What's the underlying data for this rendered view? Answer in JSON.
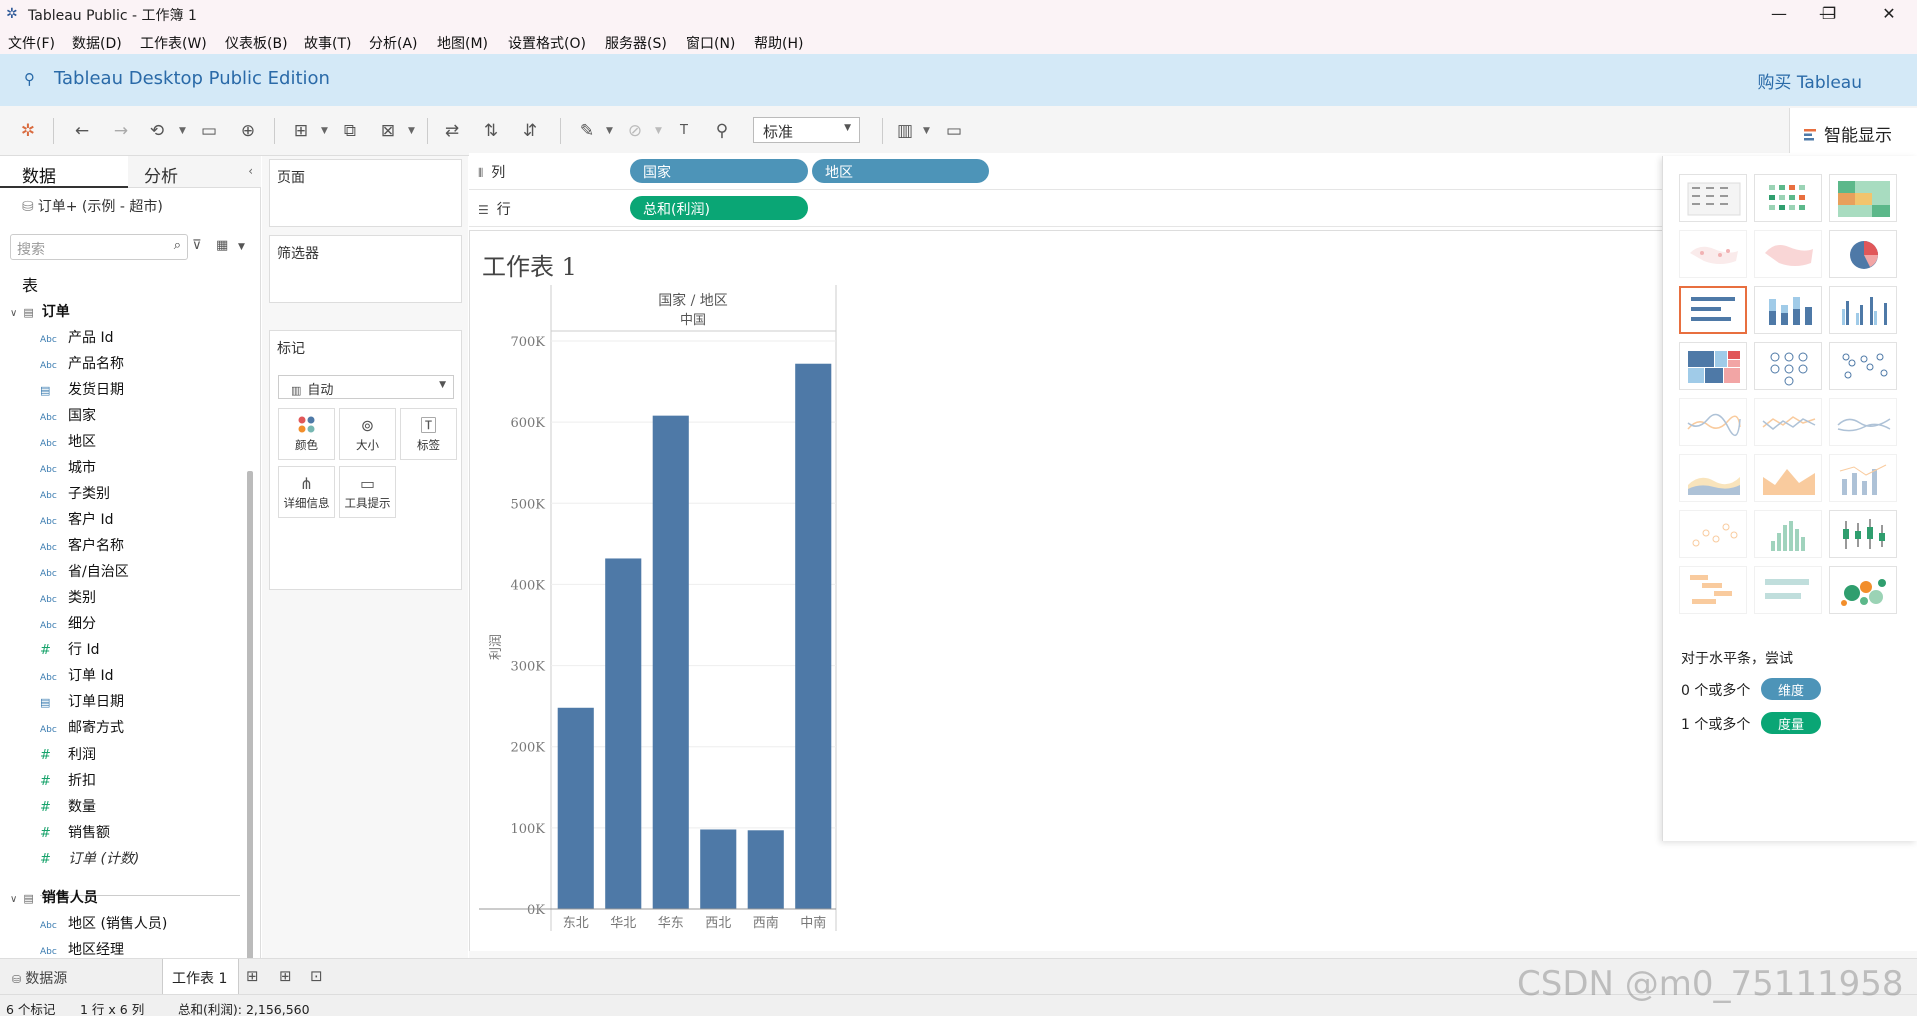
{
  "window": {
    "title": "Tableau Public - 工作簿 1",
    "minimize": "—",
    "restore": "❐",
    "close": "✕"
  },
  "menu": [
    "文件(F)",
    "数据(D)",
    "工作表(W)",
    "仪表板(B)",
    "故事(T)",
    "分析(A)",
    "地图(M)",
    "设置格式(O)",
    "服务器(S)",
    "窗口(N)",
    "帮助(H)"
  ],
  "banner": {
    "edition": "Tableau Desktop Public Edition",
    "buy": "购买 Tableau"
  },
  "toolbar": {
    "fit_value": "标准",
    "smart_show": "智能显示"
  },
  "data_pane": {
    "tab_data": "数据",
    "tab_analysis": "分析",
    "datasource": "订单+ (示例 - 超市)",
    "search_placeholder": "搜索",
    "tables_header": "表",
    "groups": [
      {
        "name": "订单",
        "fields": [
          {
            "type": "Abc",
            "name": "产品 Id"
          },
          {
            "type": "Abc",
            "name": "产品名称"
          },
          {
            "type": "date",
            "name": "发货日期"
          },
          {
            "type": "Abc",
            "name": "国家"
          },
          {
            "type": "Abc",
            "name": "地区"
          },
          {
            "type": "Abc",
            "name": "城市"
          },
          {
            "type": "Abc",
            "name": "子类别"
          },
          {
            "type": "Abc",
            "name": "客户 Id"
          },
          {
            "type": "Abc",
            "name": "客户名称"
          },
          {
            "type": "Abc",
            "name": "省/自治区"
          },
          {
            "type": "Abc",
            "name": "类别"
          },
          {
            "type": "Abc",
            "name": "细分"
          },
          {
            "type": "#",
            "name": "行 Id"
          },
          {
            "type": "Abc",
            "name": "订单 Id"
          },
          {
            "type": "date",
            "name": "订单日期"
          },
          {
            "type": "Abc",
            "name": "邮寄方式"
          }
        ],
        "measures": [
          "利润",
          "折扣",
          "数量",
          "销售额",
          "订单 (计数)"
        ]
      },
      {
        "name": "销售人员",
        "fields": [
          {
            "type": "Abc",
            "name": "地区 (销售人员)"
          },
          {
            "type": "Abc",
            "name": "地区经理"
          }
        ]
      }
    ]
  },
  "shelves": {
    "pages": "页面",
    "filters": "筛选器",
    "marks": "标记",
    "mark_type": "自动",
    "mark_buttons": [
      {
        "label": "颜色",
        "icon": "color-dots-icon"
      },
      {
        "label": "大小",
        "icon": "size-circles-icon"
      },
      {
        "label": "标签",
        "icon": "text-label-icon"
      },
      {
        "label": "详细信息",
        "icon": "detail-icon"
      },
      {
        "label": "工具提示",
        "icon": "tooltip-icon"
      }
    ],
    "columns_label": "列",
    "rows_label": "行",
    "columns_pills": [
      "国家",
      "地区"
    ],
    "rows_pills": [
      "总和(利润)"
    ]
  },
  "sheet": {
    "title": "工作表 1",
    "header_line1": "国家 / 地区",
    "header_line2": "中国"
  },
  "chart_data": {
    "type": "bar",
    "categories": [
      "东北",
      "华北",
      "华东",
      "西北",
      "西南",
      "中南"
    ],
    "values": [
      248000,
      432000,
      608000,
      98000,
      97000,
      672000
    ],
    "ylabel": "利润",
    "ylim": [
      0,
      700000
    ],
    "yticks": [
      "0K",
      "100K",
      "200K",
      "300K",
      "400K",
      "500K",
      "600K",
      "700K"
    ],
    "bar_color": "#4e79a7",
    "grid": true
  },
  "smart_show": {
    "hint": "对于水平条，尝试",
    "dims_prefix": "0 个或多个",
    "dims_pill": "维度",
    "meas_prefix": "1 个或多个",
    "meas_pill": "度量",
    "selected": "horizontal-bars"
  },
  "bottom": {
    "datasource_tab": "数据源",
    "sheet_tab": "工作表 1"
  },
  "status": {
    "marks": "6 个标记",
    "rows_cols": "1 行 x 6 列",
    "sum": "总和(利润): 2,156,560"
  },
  "watermark": "CSDN @m0_75111958",
  "colors": {
    "dim_pill": "#4d94b8",
    "meas_pill": "#0aa675",
    "banner": "#d4e9f7",
    "accent": "#e86f3f"
  }
}
